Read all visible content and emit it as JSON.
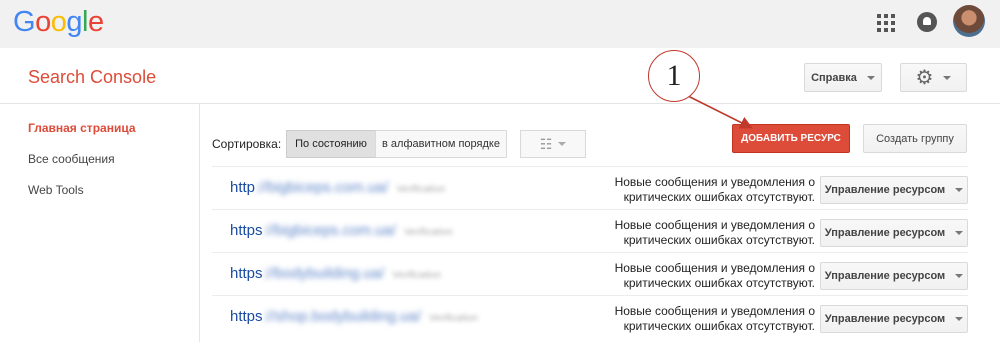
{
  "header": {
    "logo": [
      "G",
      "o",
      "o",
      "g",
      "l",
      "e"
    ],
    "logo_colors": [
      "#4285f4",
      "#ea4335",
      "#fbbc05",
      "#4285f4",
      "#34a853",
      "#ea4335"
    ],
    "icons": [
      "apps-grid-icon",
      "notifications-icon",
      "account-avatar"
    ]
  },
  "console": {
    "title": "Search Console",
    "help_label": "Справка",
    "settings_icon": "gear-icon"
  },
  "sidebar": {
    "items": [
      {
        "label": "Главная страница",
        "active": true
      },
      {
        "label": "Все сообщения",
        "active": false
      },
      {
        "label": "Web Tools",
        "active": false
      }
    ]
  },
  "toolbar": {
    "sort_label": "Сортировка:",
    "sort_by_state": "По состоянию",
    "sort_alpha": "в алфавитном порядке",
    "view_icon": "list-view-icon",
    "add_resource": "ДОБАВИТЬ РЕСУРС",
    "create_group": "Создать группу"
  },
  "annotation": {
    "number": "1",
    "color": "#c0392b"
  },
  "sites": [
    {
      "scheme": "http",
      "host": "://bigbiceps.com.ua/",
      "note": "Verification",
      "message": "Новые сообщения и уведомления о критических ошибках отсутствуют.",
      "action": "Управление ресурсом"
    },
    {
      "scheme": "https",
      "host": "://bigbiceps.com.ua/",
      "note": "Verification",
      "message": "Новые сообщения и уведомления о критических ошибках отсутствуют.",
      "action": "Управление ресурсом"
    },
    {
      "scheme": "https",
      "host": "://bodybuilding.ua/",
      "note": "Verification",
      "message": "Новые сообщения и уведомления о критических ошибках отсутствуют.",
      "action": "Управление ресурсом"
    },
    {
      "scheme": "https",
      "host": "://shop.bodybuilding.ua/",
      "note": "Verification",
      "message": "Новые сообщения и уведомления о критических ошибках отсутствуют.",
      "action": "Управление ресурсом"
    }
  ],
  "colors": {
    "accent_red": "#dd4b39",
    "link_blue": "#1a4ca1"
  }
}
